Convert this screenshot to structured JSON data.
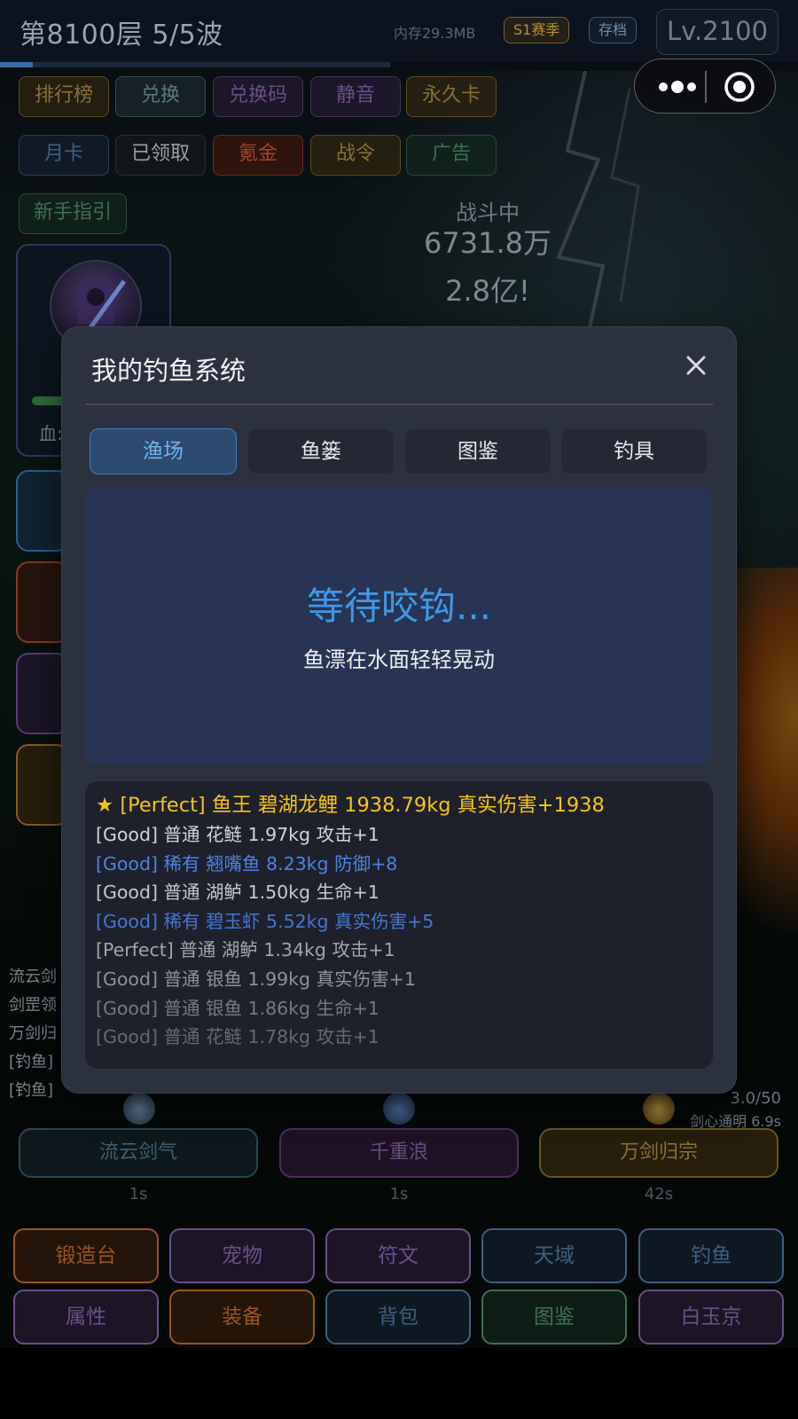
{
  "topbar": {
    "floor_wave": "第8100层  5/5波",
    "memory": "内存29.3MB",
    "season": "S1赛季",
    "save": "存档",
    "level": "Lv.2100",
    "progress_fraction": 0.085
  },
  "top_buttons_row1": [
    "排行榜",
    "兑换",
    "兑换码",
    "静音",
    "永久卡"
  ],
  "top_buttons_row2": [
    "月卡",
    "已领取",
    "氪金",
    "战令",
    "广告"
  ],
  "guide_button": "新手指引",
  "battle": {
    "status": "战斗中",
    "damage_1": "6731.8万",
    "damage_2": "2.8亿!"
  },
  "hero": {
    "hp_label": "血:",
    "hp_fraction": 0.3
  },
  "left_log": [
    "流云剑",
    "剑罡领",
    "万剑归",
    "[钓鱼]",
    "[钓鱼]"
  ],
  "skills": {
    "counter": "3.0/50",
    "buff": "剑心通明 6.9s",
    "items": [
      {
        "label": "流云剑气",
        "cd": "1s"
      },
      {
        "label": "千重浪",
        "cd": "1s"
      },
      {
        "label": "万剑归宗",
        "cd": "42s"
      }
    ]
  },
  "nav_row1": [
    "锻造台",
    "宠物",
    "符文",
    "天域",
    "钓鱼"
  ],
  "nav_row2": [
    "属性",
    "装备",
    "背包",
    "图鉴",
    "白玉京"
  ],
  "modal": {
    "title": "我的钓鱼系统",
    "tabs": [
      "渔场",
      "鱼篓",
      "图鉴",
      "钓具"
    ],
    "active_tab": 0,
    "pond_status": "等待咬钩...",
    "pond_sub": "鱼漂在水面轻轻晃动",
    "log": [
      {
        "text": "★ [Perfect] 鱼王 碧湖龙鲤 1938.79kg 真实伤害+1938",
        "color": "#f5c518"
      },
      {
        "text": "[Good] 普通 花鲢 1.97kg 攻击+1",
        "color": "#d2d4d8"
      },
      {
        "text": "[Good] 稀有 翘嘴鱼 8.23kg 防御+8",
        "color": "#4c83e6"
      },
      {
        "text": "[Good] 普通 湖鲈 1.50kg 生命+1",
        "color": "#c6c8cd"
      },
      {
        "text": "[Good] 稀有 碧玉虾 5.52kg 真实伤害+5",
        "color": "#4577d0"
      },
      {
        "text": "[Perfect] 普通 湖鲈 1.34kg 攻击+1",
        "color": "#a2a5ab"
      },
      {
        "text": "[Good] 普通 银鱼 1.99kg 真实伤害+1",
        "color": "#8f9298"
      },
      {
        "text": "[Good] 普通 银鱼 1.86kg 生命+1",
        "color": "#76797f"
      },
      {
        "text": "[Good] 普通 花鲢 1.78kg 攻击+1",
        "color": "#66696f"
      }
    ]
  }
}
